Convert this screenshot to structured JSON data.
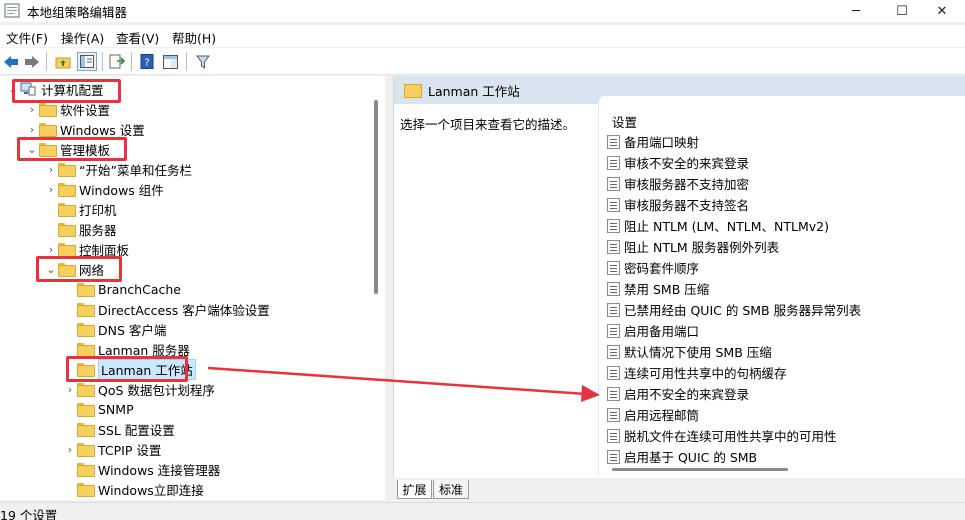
{
  "window": {
    "title": "本地组策略编辑器"
  },
  "menu": [
    "文件(F)",
    "操作(A)",
    "查看(V)",
    "帮助(H)"
  ],
  "tree": {
    "items": [
      {
        "label": "计算机配置",
        "chev": "⌄"
      },
      {
        "label": "软件设置",
        "chev": "›"
      },
      {
        "label": "Windows 设置",
        "chev": "›"
      },
      {
        "label": "管理模板",
        "chev": "⌄"
      },
      {
        "label": "“开始”菜单和任务栏",
        "chev": "›"
      },
      {
        "label": "Windows 组件",
        "chev": "›"
      },
      {
        "label": "打印机",
        "chev": ""
      },
      {
        "label": "服务器",
        "chev": ""
      },
      {
        "label": "控制面板",
        "chev": "›"
      },
      {
        "label": "网络",
        "chev": "⌄"
      },
      {
        "label": "BranchCache",
        "chev": ""
      },
      {
        "label": "DirectAccess 客户端体验设置",
        "chev": ""
      },
      {
        "label": "DNS 客户端",
        "chev": ""
      },
      {
        "label": "Lanman 服务器",
        "chev": ""
      },
      {
        "label": "Lanman 工作站",
        "chev": ""
      },
      {
        "label": "QoS 数据包计划程序",
        "chev": "›"
      },
      {
        "label": "SNMP",
        "chev": ""
      },
      {
        "label": "SSL 配置设置",
        "chev": ""
      },
      {
        "label": "TCPIP 设置",
        "chev": "›"
      },
      {
        "label": "Windows 连接管理器",
        "chev": ""
      },
      {
        "label": "Windows立即连接",
        "chev": ""
      }
    ]
  },
  "detail": {
    "header": "Lanman 工作站",
    "description": "选择一个项目来查看它的描述。",
    "column_header": "设置",
    "settings": [
      "备用端口映射",
      "审核不安全的来宾登录",
      "审核服务器不支持加密",
      "审核服务器不支持签名",
      "阻止 NTLM (LM、NTLM、NTLMv2)",
      "阻止 NTLM 服务器例外列表",
      "密码套件顺序",
      "禁用 SMB 压缩",
      "已禁用经由 QUIC 的 SMB 服务器异常列表",
      "启用备用端口",
      "默认情况下使用 SMB 压缩",
      "连续可用性共享中的句柄缓存",
      "启用不安全的来宾登录",
      "启用远程邮筒",
      "脱机文件在连续可用性共享中的可用性",
      "启用基于 QUIC 的 SMB"
    ]
  },
  "tabs": [
    "扩展",
    "标准"
  ],
  "status": {
    "text": "19 个设置"
  },
  "colors": {
    "annotation": "#e8323c",
    "header_bg": "#d9e4f0",
    "selection": "#cce8ff"
  }
}
